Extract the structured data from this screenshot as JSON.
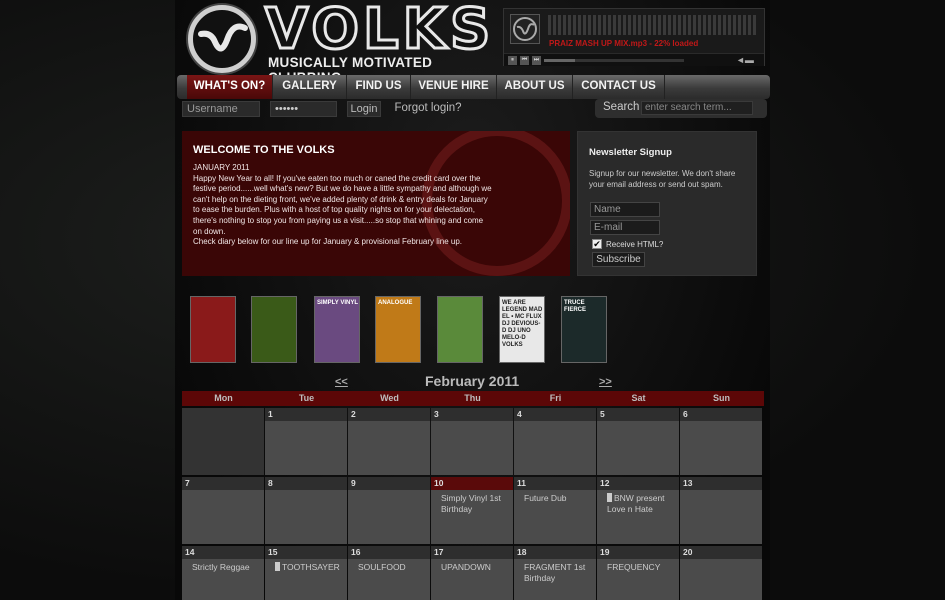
{
  "logo": {
    "word": "VOLKS",
    "tagline": "MUSICALLY MOTIVATED CLUBBING"
  },
  "player": {
    "track": "PRAIZ MASH UP MIX.mp3 - 22% loaded",
    "progress": 0.22,
    "controls": [
      "⏸",
      "⏮",
      "⏭"
    ],
    "volume": "◄▬"
  },
  "nav": {
    "items": [
      "WHAT'S ON?",
      "GALLERY",
      "FIND US",
      "VENUE HIRE",
      "ABOUT US",
      "CONTACT US"
    ]
  },
  "login": {
    "username": "Username",
    "password": "••••••",
    "button": "Login",
    "forgot": "Forgot login?"
  },
  "search": {
    "label": "Search",
    "placeholder": "enter search term..."
  },
  "welcome": {
    "title": "WELCOME TO THE VOLKS",
    "body": "JANUARY 2011\nHappy New Year to all!  If you've eaten too much or caned the credit card over the festive period......well what's new?  But we do have a little sympathy and although we can't help on the dieting front, we've added plenty of drink & entry deals for January to ease the burden.  Plus with a host of top quality nights on for your delectation, there's nothing to stop you from paying us a visit.....so stop that whining and come on down.\nCheck diary below for our line up for January & provisional February line up."
  },
  "newsletter": {
    "title": "Newsletter Signup",
    "desc": "Signup for our newsletter. We don't share your email address or send out spam.",
    "name_placeholder": "Name",
    "email_placeholder": "E-mail",
    "check_label": "Receive HTML?",
    "submit": "Subscribe"
  },
  "flyers": [
    {
      "label": "",
      "color": "#8a1a1a"
    },
    {
      "label": "",
      "color": "#3a5a18"
    },
    {
      "label": "SIMPLY VINYL",
      "color": "#6a4a80"
    },
    {
      "label": "ANALOGUE",
      "color": "#c07a18"
    },
    {
      "label": "",
      "color": "#5a8a3a"
    },
    {
      "label": "WE ARE LEGEND MAD EL • MC FLUX DJ DEVIOUS-D DJ UNO MELO-D VOLKS",
      "color": "#e8e8e8"
    },
    {
      "label": "TRUCE FIERCE",
      "color": "#1c2a2a"
    }
  ],
  "calendar": {
    "prev": "<<",
    "next": ">>",
    "title": "February 2011",
    "days": [
      "Mon",
      "Tue",
      "Wed",
      "Thu",
      "Fri",
      "Sat",
      "Sun"
    ],
    "weeks": [
      [
        {
          "num": "",
          "events": []
        },
        {
          "num": "1",
          "events": []
        },
        {
          "num": "2",
          "events": []
        },
        {
          "num": "3",
          "events": []
        },
        {
          "num": "4",
          "events": []
        },
        {
          "num": "5",
          "events": []
        },
        {
          "num": "6",
          "events": []
        }
      ],
      [
        {
          "num": "7",
          "events": []
        },
        {
          "num": "8",
          "events": []
        },
        {
          "num": "9",
          "events": []
        },
        {
          "num": "10",
          "events": [
            "Simply Vinyl 1st Birthday"
          ],
          "highlight": true
        },
        {
          "num": "11",
          "events": [
            "Future Dub"
          ]
        },
        {
          "num": "12",
          "events": [
            "BNW present Love n Hate"
          ],
          "marked": true
        },
        {
          "num": "13",
          "events": []
        }
      ],
      [
        {
          "num": "14",
          "events": [
            "Strictly Reggae"
          ]
        },
        {
          "num": "15",
          "events": [
            "TOOTHSAYER"
          ],
          "marked": true
        },
        {
          "num": "16",
          "events": [
            "SOULFOOD"
          ]
        },
        {
          "num": "17",
          "events": [
            "UPANDOWN"
          ]
        },
        {
          "num": "18",
          "events": [
            "FRAGMENT 1st Birthday"
          ]
        },
        {
          "num": "19",
          "events": [
            "FREQUENCY"
          ]
        },
        {
          "num": "20",
          "events": []
        }
      ]
    ]
  }
}
